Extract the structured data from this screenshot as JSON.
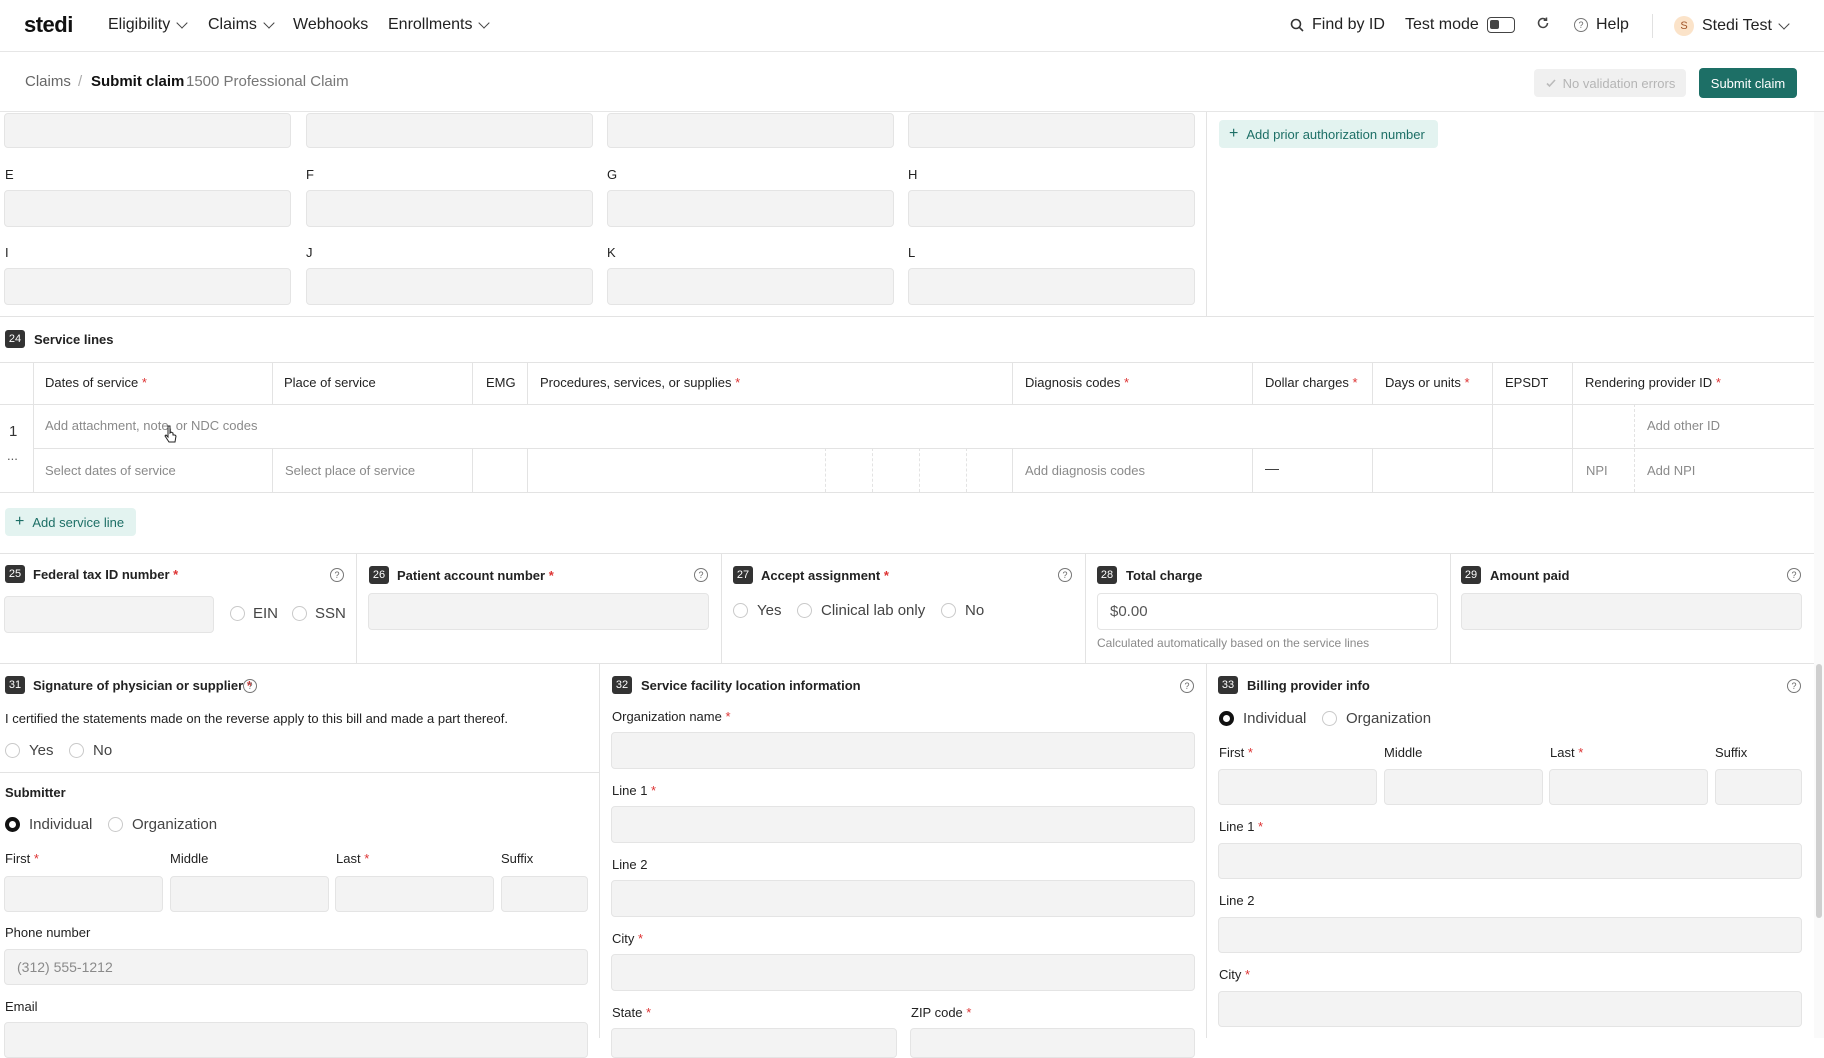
{
  "nav": {
    "logo": "stedi",
    "items": [
      "Eligibility",
      "Claims",
      "Webhooks",
      "Enrollments"
    ],
    "find_by_id": "Find by ID",
    "test_mode": "Test mode",
    "help": "Help",
    "avatar_letter": "S",
    "account": "Stedi Test"
  },
  "breadcrumb": {
    "root": "Claims",
    "current": "Submit claim",
    "subtitle": "1500 Professional Claim"
  },
  "actions": {
    "validation": "No validation errors",
    "submit": "Submit claim"
  },
  "diagnosis": {
    "letters": [
      "E",
      "F",
      "G",
      "H",
      "I",
      "J",
      "K",
      "L"
    ],
    "prior_auth": "Add prior authorization number"
  },
  "service_lines": {
    "number": "24",
    "title": "Service lines",
    "headers": [
      "Dates of service",
      "Place of service",
      "EMG",
      "Procedures, services, or supplies",
      "Diagnosis codes",
      "Dollar charges",
      "Days or units",
      "EPSDT",
      "Rendering provider ID"
    ],
    "row_number": "1",
    "more": "...",
    "attachment": "Add attachment, note, or NDC codes",
    "other_id": "Add other ID",
    "select_dates": "Select dates of service",
    "select_place": "Select place of service",
    "add_diag": "Add diagnosis codes",
    "dash": "—",
    "npi": "NPI",
    "add_npi": "Add NPI",
    "add_line": "Add service line"
  },
  "box25": {
    "num": "25",
    "title": "Federal tax ID number",
    "ein": "EIN",
    "ssn": "SSN"
  },
  "box26": {
    "num": "26",
    "title": "Patient account number"
  },
  "box27": {
    "num": "27",
    "title": "Accept assignment",
    "yes": "Yes",
    "clinical": "Clinical lab only",
    "no": "No"
  },
  "box28": {
    "num": "28",
    "title": "Total charge",
    "value": "$0.00",
    "note": "Calculated automatically based on the service lines"
  },
  "box29": {
    "num": "29",
    "title": "Amount paid"
  },
  "box31": {
    "num": "31",
    "title": "Signature of physician or supplier",
    "statement": "I certified the statements made on the reverse apply to this bill and made a part thereof.",
    "yes": "Yes",
    "no": "No",
    "submitter": "Submitter",
    "individual": "Individual",
    "organization": "Organization",
    "first": "First",
    "middle": "Middle",
    "last": "Last",
    "suffix": "Suffix",
    "phone": "Phone number",
    "phone_placeholder": "(312) 555-1212",
    "email": "Email"
  },
  "box32": {
    "num": "32",
    "title": "Service facility location information",
    "org": "Organization name",
    "line1": "Line 1",
    "line2": "Line 2",
    "city": "City",
    "state": "State",
    "zip": "ZIP code"
  },
  "box33": {
    "num": "33",
    "title": "Billing provider info",
    "individual": "Individual",
    "organization": "Organization",
    "first": "First",
    "middle": "Middle",
    "last": "Last",
    "suffix": "Suffix",
    "line1": "Line 1",
    "line2": "Line 2",
    "city": "City"
  },
  "colors": {
    "accent": "#1d6f66",
    "required": "#dd3333"
  }
}
